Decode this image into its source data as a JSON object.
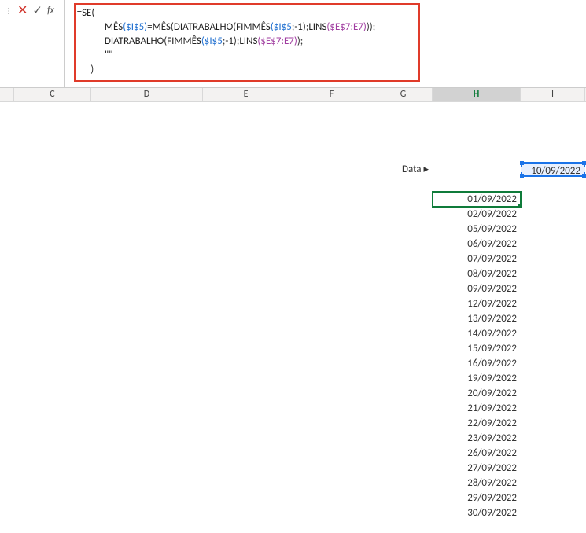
{
  "formula_bar": {
    "fx_label": "fx",
    "line1_a": "=SE(",
    "line2_fn1": "MÊS",
    "line2_ref1": "($I$5)",
    "line2_eq": "=",
    "line2_fn2": "MÊS",
    "line2_open": "(",
    "line2_fn3": "DIATRABALHO",
    "line2_open2": "(",
    "line2_fn4": "FIMMÊS",
    "line2_args4": "($I$5",
    "line2_sep": ";",
    "line2_num": "-1",
    "line2_close4": ");",
    "line2_fn5": "LINS",
    "line2_args5": "($E$7:E7)",
    "line2_close_all": ")",
    "line2_close_outer": ");",
    "line3_fn1": "DIATRABALHO",
    "line3_open": "(",
    "line3_fn2": "FIMMÊS",
    "line3_args2": "($I$5",
    "line3_sep": ";",
    "line3_num": "-1",
    "line3_close2": ");",
    "line3_fn3": "LINS",
    "line3_args3": "($E$7:E7)",
    "line3_close": ");",
    "line4": "\"\"",
    "line5": ")"
  },
  "columns": {
    "C": "C",
    "D": "D",
    "E": "E",
    "F": "F",
    "G": "G",
    "H": "H",
    "I": "I"
  },
  "data_label": "Data ▸",
  "input_date": "10/09/2022",
  "dates": [
    "01/09/2022",
    "02/09/2022",
    "05/09/2022",
    "06/09/2022",
    "07/09/2022",
    "08/09/2022",
    "09/09/2022",
    "12/09/2022",
    "13/09/2022",
    "14/09/2022",
    "15/09/2022",
    "16/09/2022",
    "19/09/2022",
    "20/09/2022",
    "21/09/2022",
    "22/09/2022",
    "23/09/2022",
    "26/09/2022",
    "27/09/2022",
    "28/09/2022",
    "29/09/2022",
    "30/09/2022"
  ]
}
